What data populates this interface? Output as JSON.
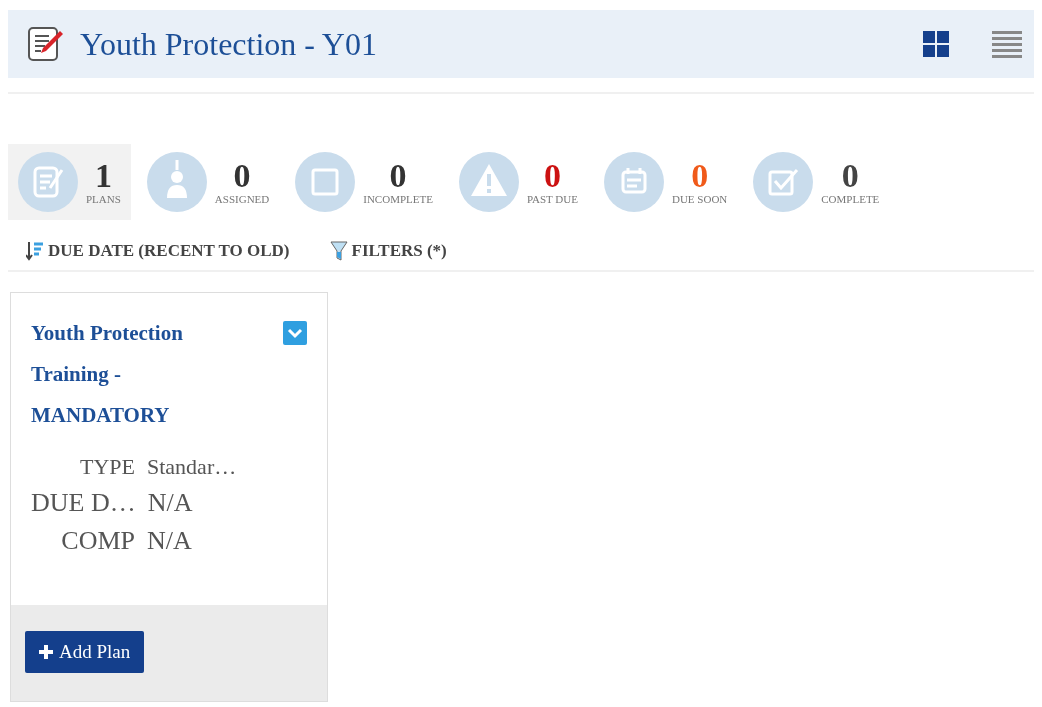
{
  "header": {
    "title": "Youth Protection - Y01",
    "views": [
      {
        "kind": "grid",
        "selected": true
      },
      {
        "kind": "list",
        "selected": false
      }
    ]
  },
  "stats": [
    {
      "kind": "plans",
      "count": "1",
      "label": "PLANS",
      "selected": true,
      "color": "#333333"
    },
    {
      "kind": "assigned",
      "count": "0",
      "label": "ASSIGNED",
      "selected": false,
      "color": "#333333"
    },
    {
      "kind": "incomplete",
      "count": "0",
      "label": "INCOMPLETE",
      "selected": false,
      "color": "#333333"
    },
    {
      "kind": "past_due",
      "count": "0",
      "label": "PAST DUE",
      "selected": false,
      "color": "#cc1111"
    },
    {
      "kind": "due_soon",
      "count": "0",
      "label": "DUE SOON",
      "selected": false,
      "color": "#f05a1a"
    },
    {
      "kind": "complete",
      "count": "0",
      "label": "COMPLETE",
      "selected": false,
      "color": "#444444"
    }
  ],
  "toolbar": {
    "sort": "DUE DATE (RECENT TO OLD)",
    "filters": "FILTERS (*)"
  },
  "card": {
    "title": "Youth Protection Training - MANDATORY",
    "fields": [
      {
        "label": "TYPE",
        "value": "Standar…"
      },
      {
        "label": "DUE D…",
        "value": "N/A"
      },
      {
        "label": "COMP",
        "value": "N/A"
      }
    ],
    "button": "Add Plan"
  }
}
